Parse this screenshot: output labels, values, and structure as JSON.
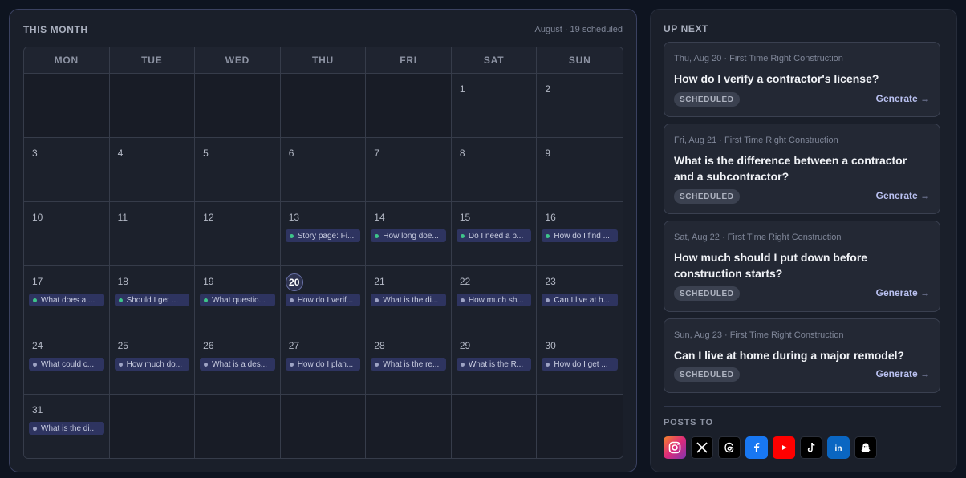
{
  "calendar": {
    "title": "THIS MONTH",
    "subtitle": "August · 19 scheduled",
    "weekdays": [
      "MON",
      "TUE",
      "WED",
      "THU",
      "FRI",
      "SAT",
      "SUN"
    ],
    "today": 20,
    "days": [
      {
        "n": "",
        "post": null
      },
      {
        "n": "",
        "post": null
      },
      {
        "n": "",
        "post": null
      },
      {
        "n": "",
        "post": null
      },
      {
        "n": "",
        "post": null
      },
      {
        "n": "1",
        "post": null
      },
      {
        "n": "2",
        "post": null
      },
      {
        "n": "3",
        "post": null
      },
      {
        "n": "4",
        "post": null
      },
      {
        "n": "5",
        "post": null
      },
      {
        "n": "6",
        "post": null
      },
      {
        "n": "7",
        "post": null
      },
      {
        "n": "8",
        "post": null
      },
      {
        "n": "9",
        "post": null
      },
      {
        "n": "10",
        "post": null
      },
      {
        "n": "11",
        "post": null
      },
      {
        "n": "12",
        "post": null
      },
      {
        "n": "13",
        "post": {
          "text": "Story page: Fi...",
          "status": "live"
        }
      },
      {
        "n": "14",
        "post": {
          "text": "How long doe...",
          "status": "live"
        }
      },
      {
        "n": "15",
        "post": {
          "text": "Do I need a p...",
          "status": "live"
        }
      },
      {
        "n": "16",
        "post": {
          "text": "How do I find ...",
          "status": "live"
        }
      },
      {
        "n": "17",
        "post": {
          "text": "What does a ...",
          "status": "live"
        }
      },
      {
        "n": "18",
        "post": {
          "text": "Should I get ...",
          "status": "live"
        }
      },
      {
        "n": "19",
        "post": {
          "text": "What questio...",
          "status": "live"
        }
      },
      {
        "n": "20",
        "post": {
          "text": "How do I verif...",
          "status": "sched"
        }
      },
      {
        "n": "21",
        "post": {
          "text": "What is the di...",
          "status": "sched"
        }
      },
      {
        "n": "22",
        "post": {
          "text": "How much sh...",
          "status": "sched"
        }
      },
      {
        "n": "23",
        "post": {
          "text": "Can I live at h...",
          "status": "sched"
        }
      },
      {
        "n": "24",
        "post": {
          "text": "What could c...",
          "status": "sched"
        }
      },
      {
        "n": "25",
        "post": {
          "text": "How much do...",
          "status": "sched"
        }
      },
      {
        "n": "26",
        "post": {
          "text": "What is a des...",
          "status": "sched"
        }
      },
      {
        "n": "27",
        "post": {
          "text": "How do I plan...",
          "status": "sched"
        }
      },
      {
        "n": "28",
        "post": {
          "text": "What is the re...",
          "status": "sched"
        }
      },
      {
        "n": "29",
        "post": {
          "text": "What is the R...",
          "status": "sched"
        }
      },
      {
        "n": "30",
        "post": {
          "text": "How do I get ...",
          "status": "sched"
        }
      },
      {
        "n": "31",
        "post": {
          "text": "What is the di...",
          "status": "sched"
        }
      },
      {
        "n": "",
        "post": null
      },
      {
        "n": "",
        "post": null
      },
      {
        "n": "",
        "post": null
      },
      {
        "n": "",
        "post": null
      },
      {
        "n": "",
        "post": null
      },
      {
        "n": "",
        "post": null
      }
    ]
  },
  "upnext": {
    "title": "UP NEXT",
    "cards": [
      {
        "meta": "Thu, Aug 20 · First Time Right Construction",
        "question": "How do I verify a contractor's license?",
        "badge": "SCHEDULED",
        "action": "Generate →"
      },
      {
        "meta": "Fri, Aug 21 · First Time Right Construction",
        "question": "What is the difference between a contractor and a subcontractor?",
        "badge": "SCHEDULED",
        "action": "Generate →"
      },
      {
        "meta": "Sat, Aug 22 · First Time Right Construction",
        "question": "How much should I put down before construction starts?",
        "badge": "SCHEDULED",
        "action": "Generate →"
      },
      {
        "meta": "Sun, Aug 23 · First Time Right Construction",
        "question": "Can I live at home during a major remodel?",
        "badge": "SCHEDULED",
        "action": "Generate →"
      }
    ]
  },
  "posts_to": {
    "title": "POSTS TO",
    "platforms": [
      {
        "name": "instagram-icon",
        "color": "#dd4b8a"
      },
      {
        "name": "x-icon",
        "color": "#000000"
      },
      {
        "name": "threads-icon",
        "color": "#000000"
      },
      {
        "name": "facebook-icon",
        "color": "#1877f2"
      },
      {
        "name": "youtube-icon",
        "color": "#ff0000"
      },
      {
        "name": "tiktok-icon",
        "color": "#000000"
      },
      {
        "name": "linkedin-icon",
        "color": "#0a66c2"
      },
      {
        "name": "snapchat-icon",
        "color": "#000000"
      }
    ]
  }
}
